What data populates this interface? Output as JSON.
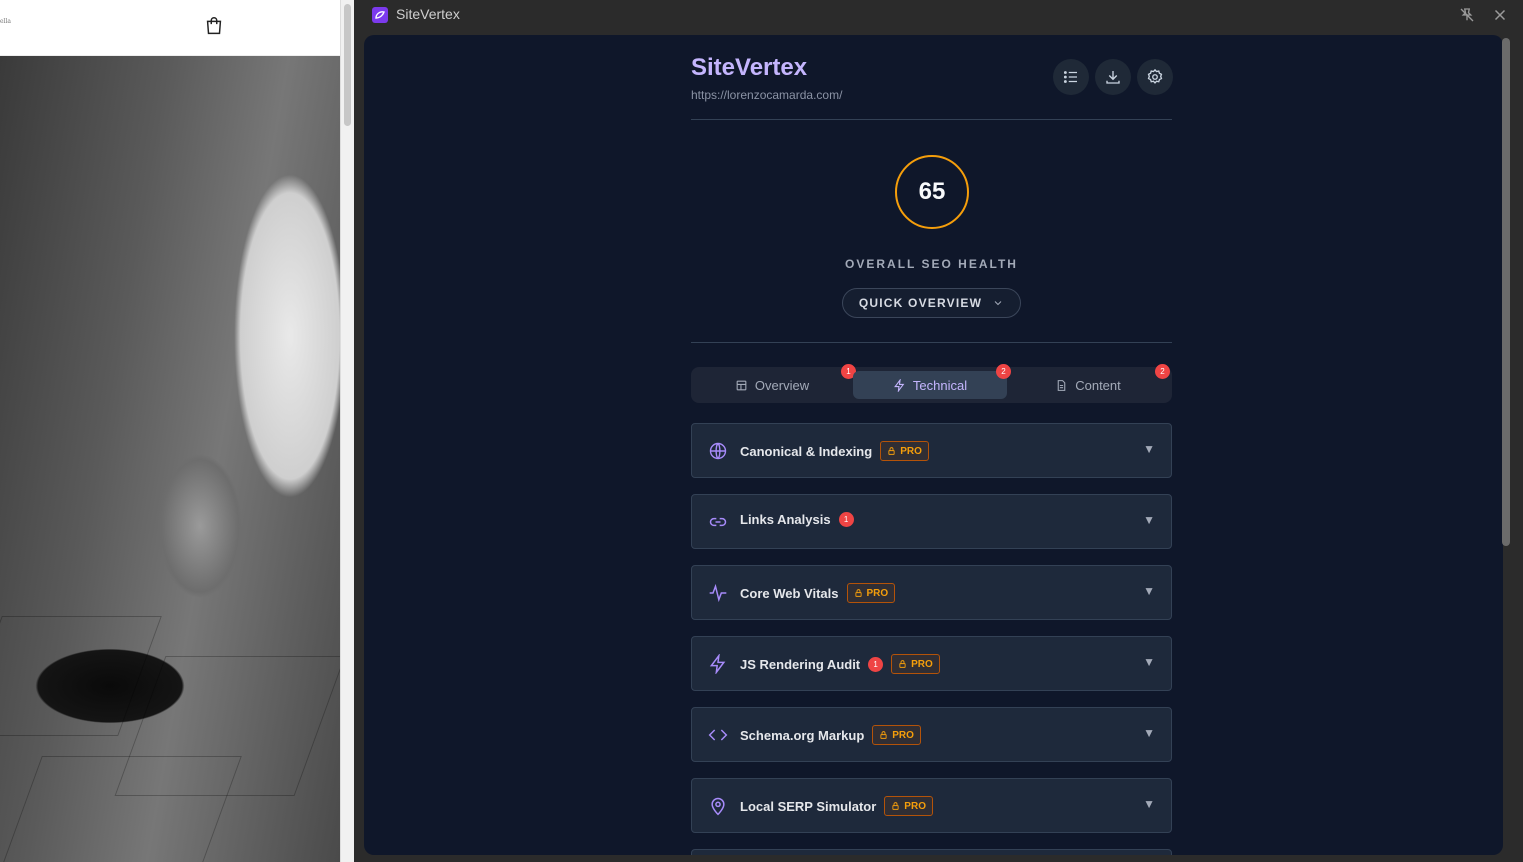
{
  "window": {
    "title": "SiteVertex"
  },
  "website": {
    "logo_text": "ella"
  },
  "header": {
    "brand": "SiteVertex",
    "url": "https://lorenzocamarda.com/"
  },
  "score": {
    "value": "65",
    "label": "OVERALL SEO HEALTH",
    "color": "#f59e0b"
  },
  "quick_overview": {
    "label": "QUICK OVERVIEW"
  },
  "tabs": [
    {
      "label": "Overview",
      "badge": "1"
    },
    {
      "label": "Technical",
      "badge": "2"
    },
    {
      "label": "Content",
      "badge": "2"
    }
  ],
  "pro_label": "PRO",
  "sections": [
    {
      "title": "Canonical & Indexing",
      "pro": true,
      "count": ""
    },
    {
      "title": "Links Analysis",
      "pro": false,
      "count": "1"
    },
    {
      "title": "Core Web Vitals",
      "pro": true,
      "count": ""
    },
    {
      "title": "JS Rendering Audit",
      "pro": true,
      "count": "1"
    },
    {
      "title": "Schema.org Markup",
      "pro": true,
      "count": ""
    },
    {
      "title": "Local SERP Simulator",
      "pro": true,
      "count": ""
    }
  ],
  "colors": {
    "accent": "#c4b5fd",
    "panel": "#0f172a",
    "badge": "#ef4444",
    "pro": "#f59e0b"
  }
}
